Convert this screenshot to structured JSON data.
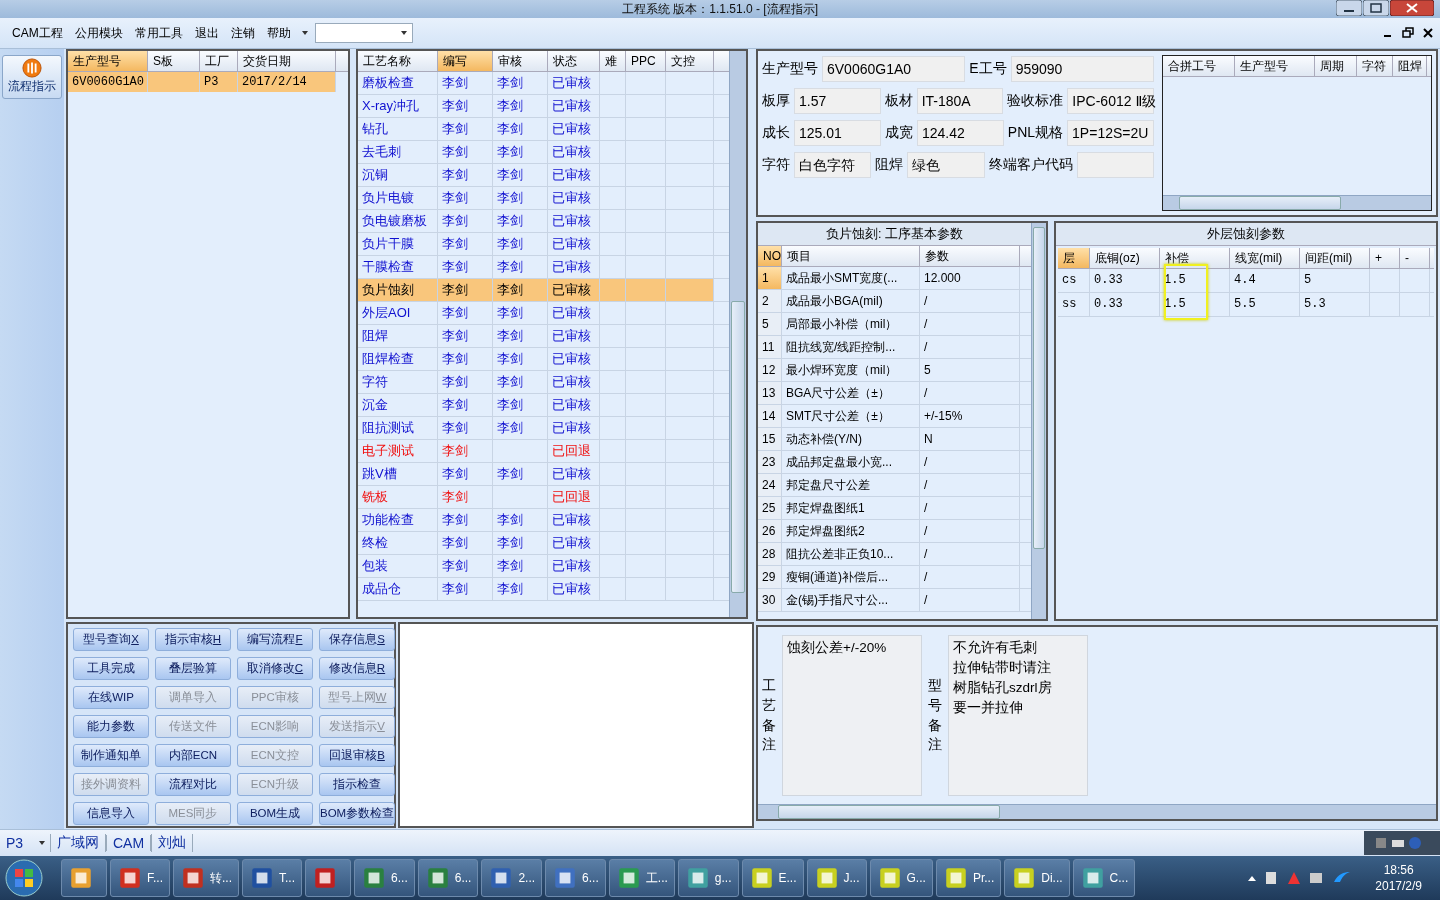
{
  "window": {
    "title": "工程系统    版本：1.1.51.0 - [流程指示]"
  },
  "menu": [
    {
      "label": "CAM工程"
    },
    {
      "label": "公用模块"
    },
    {
      "label": "常用工具"
    },
    {
      "label": "退出"
    },
    {
      "label": "注销"
    },
    {
      "label": "帮助"
    }
  ],
  "sidebar": {
    "button": "流程指示"
  },
  "jobs": {
    "columns": [
      {
        "label": "生产型号",
        "selected": true
      },
      {
        "label": "S板",
        "selected": false
      },
      {
        "label": "工厂",
        "selected": false
      },
      {
        "label": "交货日期",
        "selected": false
      }
    ],
    "rows": [
      {
        "cells": [
          "6V0060G1A0",
          "",
          "P3",
          "2017/2/14"
        ],
        "selected": true
      }
    ]
  },
  "process": {
    "columns": [
      {
        "label": "工艺名称",
        "selected": false
      },
      {
        "label": "编写",
        "selected": true
      },
      {
        "label": "审核",
        "selected": false
      },
      {
        "label": "状态",
        "selected": false
      },
      {
        "label": "难",
        "selected": false
      },
      {
        "label": "PPC",
        "selected": false
      },
      {
        "label": "文控",
        "selected": false
      }
    ],
    "rows": [
      {
        "name": "磨板检查",
        "writer": "李剑",
        "reviewer": "李剑",
        "status": "已审核",
        "rejected": false,
        "selected": false
      },
      {
        "name": "X-ray冲孔",
        "writer": "李剑",
        "reviewer": "李剑",
        "status": "已审核",
        "rejected": false,
        "selected": false
      },
      {
        "name": "钻孔",
        "writer": "李剑",
        "reviewer": "李剑",
        "status": "已审核",
        "rejected": false,
        "selected": false
      },
      {
        "name": "去毛刺",
        "writer": "李剑",
        "reviewer": "李剑",
        "status": "已审核",
        "rejected": false,
        "selected": false
      },
      {
        "name": "沉铜",
        "writer": "李剑",
        "reviewer": "李剑",
        "status": "已审核",
        "rejected": false,
        "selected": false
      },
      {
        "name": "负片电镀",
        "writer": "李剑",
        "reviewer": "李剑",
        "status": "已审核",
        "rejected": false,
        "selected": false
      },
      {
        "name": "负电镀磨板",
        "writer": "李剑",
        "reviewer": "李剑",
        "status": "已审核",
        "rejected": false,
        "selected": false
      },
      {
        "name": "负片干膜",
        "writer": "李剑",
        "reviewer": "李剑",
        "status": "已审核",
        "rejected": false,
        "selected": false
      },
      {
        "name": "干膜检查",
        "writer": "李剑",
        "reviewer": "李剑",
        "status": "已审核",
        "rejected": false,
        "selected": false
      },
      {
        "name": "负片蚀刻",
        "writer": "李剑",
        "reviewer": "李剑",
        "status": "已审核",
        "rejected": false,
        "selected": true
      },
      {
        "name": "外层AOI",
        "writer": "李剑",
        "reviewer": "李剑",
        "status": "已审核",
        "rejected": false,
        "selected": false
      },
      {
        "name": "阻焊",
        "writer": "李剑",
        "reviewer": "李剑",
        "status": "已审核",
        "rejected": false,
        "selected": false
      },
      {
        "name": "阻焊检查",
        "writer": "李剑",
        "reviewer": "李剑",
        "status": "已审核",
        "rejected": false,
        "selected": false
      },
      {
        "name": "字符",
        "writer": "李剑",
        "reviewer": "李剑",
        "status": "已审核",
        "rejected": false,
        "selected": false
      },
      {
        "name": "沉金",
        "writer": "李剑",
        "reviewer": "李剑",
        "status": "已审核",
        "rejected": false,
        "selected": false
      },
      {
        "name": "阻抗测试",
        "writer": "李剑",
        "reviewer": "李剑",
        "status": "已审核",
        "rejected": false,
        "selected": false
      },
      {
        "name": "电子测试",
        "writer": "李剑",
        "status": "已回退",
        "rejected": true,
        "selected": false
      },
      {
        "name": "跳V槽",
        "writer": "李剑",
        "reviewer": "李剑",
        "status": "已审核",
        "rejected": false,
        "selected": false
      },
      {
        "name": "铣板",
        "writer": "李剑",
        "status": "已回退",
        "rejected": true,
        "selected": false
      },
      {
        "name": "功能检查",
        "writer": "李剑",
        "reviewer": "李剑",
        "status": "已审核",
        "rejected": false,
        "selected": false
      },
      {
        "name": "终检",
        "writer": "李剑",
        "reviewer": "李剑",
        "status": "已审核",
        "rejected": false,
        "selected": false
      },
      {
        "name": "包装",
        "writer": "李剑",
        "reviewer": "李剑",
        "status": "已审核",
        "rejected": false,
        "selected": false
      },
      {
        "name": "成品仓",
        "writer": "李剑",
        "reviewer": "李剑",
        "status": "已审核",
        "rejected": false,
        "selected": false
      }
    ]
  },
  "actions": [
    {
      "label": "型号查询",
      "key": "X",
      "disabled": false
    },
    {
      "label": "指示审核",
      "key": "H",
      "disabled": false
    },
    {
      "label": "编写流程",
      "key": "F",
      "disabled": false
    },
    {
      "label": "保存信息",
      "key": "S",
      "disabled": false
    },
    {
      "label": "工具完成",
      "disabled": false
    },
    {
      "label": "叠层验算",
      "disabled": false
    },
    {
      "label": "取消修改",
      "key": "C",
      "disabled": false
    },
    {
      "label": "修改信息",
      "key": "R",
      "disabled": false
    },
    {
      "label": "在线WIP",
      "disabled": false
    },
    {
      "label": "调单导入",
      "disabled": true
    },
    {
      "label": "PPC审核",
      "disabled": true
    },
    {
      "label": "型号上网",
      "key": "W",
      "disabled": true
    },
    {
      "label": "能力参数",
      "disabled": false
    },
    {
      "label": "传送文件",
      "disabled": true
    },
    {
      "label": "ECN影响",
      "disabled": true
    },
    {
      "label": "发送指示",
      "key": "V",
      "disabled": true
    },
    {
      "label": "制作通知单",
      "disabled": false
    },
    {
      "label": "内部ECN",
      "disabled": false
    },
    {
      "label": "ECN文控",
      "disabled": true
    },
    {
      "label": "回退审核",
      "key": "B",
      "disabled": false
    },
    {
      "label": "接外调资料",
      "disabled": true
    },
    {
      "label": "流程对比",
      "disabled": false
    },
    {
      "label": "ECN升级",
      "disabled": true
    },
    {
      "label": "指示检查",
      "disabled": false
    },
    {
      "label": "信息导入",
      "disabled": false
    },
    {
      "label": "MES同步",
      "disabled": true
    },
    {
      "label": "BOM生成",
      "disabled": false
    },
    {
      "label": "BOM参数检查",
      "disabled": false
    }
  ],
  "info": [
    [
      {
        "label": "生产型号",
        "value": "6V0060G1A0"
      },
      {
        "label": "E工号",
        "value": "959090"
      }
    ],
    [
      {
        "label": "板厚",
        "value": "1.57"
      },
      {
        "label": "板材",
        "value": "IT-180A"
      },
      {
        "label": "验收标准",
        "value": "IPC-6012 Ⅱ级"
      }
    ],
    [
      {
        "label": "成长",
        "value": "125.01"
      },
      {
        "label": "成宽",
        "value": "124.42"
      },
      {
        "label": "PNL规格",
        "value": "1P=12S=2U"
      }
    ],
    [
      {
        "label": "字符",
        "value": "白色字符"
      },
      {
        "label": "阻焊",
        "value": "绿色"
      },
      {
        "label": "终端客户代码"
      }
    ]
  ],
  "merge_table": {
    "columns": [
      "合拼工号",
      "生产型号",
      "周期",
      "字符",
      "阻焊"
    ]
  },
  "params": {
    "title": "负片蚀刻: 工序基本参数",
    "columns": [
      "NO",
      "项目",
      "参数"
    ],
    "rows": [
      {
        "no": "1",
        "item": "成品最小SMT宽度(...",
        "value": "12.000",
        "selected": true
      },
      {
        "no": "2",
        "item": "成品最小BGA(mil)",
        "value": "/",
        "selected": false
      },
      {
        "no": "5",
        "item": "局部最小补偿（mil）",
        "value": "/",
        "selected": false
      },
      {
        "no": "11",
        "item": "阻抗线宽/线距控制...",
        "value": "/",
        "selected": false
      },
      {
        "no": "12",
        "item": "最小焊环宽度（mil）",
        "value": "5",
        "selected": false
      },
      {
        "no": "13",
        "item": "BGA尺寸公差（±）",
        "value": "/",
        "selected": false
      },
      {
        "no": "14",
        "item": "SMT尺寸公差（±）",
        "value": "+/-15%",
        "selected": false
      },
      {
        "no": "15",
        "item": "动态补偿(Y/N)",
        "value": "N",
        "selected": false
      },
      {
        "no": "23",
        "item": "成品邦定盘最小宽...",
        "value": "/",
        "selected": false
      },
      {
        "no": "24",
        "item": "邦定盘尺寸公差",
        "value": "/",
        "selected": false
      },
      {
        "no": "25",
        "item": "邦定焊盘图纸1",
        "value": "/",
        "selected": false
      },
      {
        "no": "26",
        "item": "邦定焊盘图纸2",
        "value": "/",
        "selected": false
      },
      {
        "no": "28",
        "item": "阻抗公差非正负10...",
        "value": "/",
        "selected": false
      },
      {
        "no": "29",
        "item": "瘦铜(通道)补偿后...",
        "value": "/",
        "selected": false
      },
      {
        "no": "30",
        "item": "金(锡)手指尺寸公...",
        "value": "/",
        "selected": false
      }
    ]
  },
  "outer": {
    "title": "外层蚀刻参数",
    "columns": [
      {
        "label": "层",
        "highlighted": false
      },
      {
        "label": "底铜(oz)",
        "highlighted": false
      },
      {
        "label": "补偿",
        "highlighted": true
      },
      {
        "label": "线宽(mil)",
        "highlighted": false
      },
      {
        "label": "间距(mil)",
        "highlighted": false
      },
      {
        "label": "+",
        "highlighted": false
      },
      {
        "label": "-",
        "highlighted": false
      }
    ],
    "rows": [
      [
        "cs",
        "0.33",
        "1.5",
        "4.4",
        "5"
      ],
      [
        "ss",
        "0.33",
        "1.5",
        "5.5",
        "5.3"
      ]
    ]
  },
  "remarks": [
    {
      "label": "工艺备注",
      "lines": [
        "蚀刻公差+/-20%"
      ]
    },
    {
      "label": "型号备注",
      "lines": [
        "不允许有毛刺",
        "拉伸钻带时请注",
        "树脂钻孔szdrl房",
        "要一并拉伸"
      ]
    }
  ],
  "status_bar": {
    "factory": "P3",
    "items": [
      "广域网",
      "CAM",
      "刘灿"
    ]
  },
  "taskbar": {
    "items": [
      {
        "kind": "window"
      },
      {
        "kind": "window",
        "label": "F..."
      },
      {
        "kind": "window",
        "label": "转..."
      },
      {
        "kind": "window",
        "label": "T..."
      },
      {
        "kind": "window"
      },
      {
        "kind": "window",
        "label": "6..."
      },
      {
        "kind": "window",
        "label": "6..."
      },
      {
        "kind": "window",
        "label": "2..."
      },
      {
        "kind": "window",
        "label": "6..."
      },
      {
        "kind": "window",
        "label": "工..."
      },
      {
        "kind": "window",
        "label": "g..."
      },
      {
        "kind": "window",
        "label": "E..."
      },
      {
        "kind": "window",
        "label": "J..."
      },
      {
        "kind": "window",
        "label": "G..."
      },
      {
        "kind": "window",
        "label": "Pr..."
      },
      {
        "kind": "window",
        "label": "Di..."
      },
      {
        "kind": "window",
        "label": "C..."
      }
    ],
    "time": "18:56",
    "date": "2017/2/9"
  }
}
